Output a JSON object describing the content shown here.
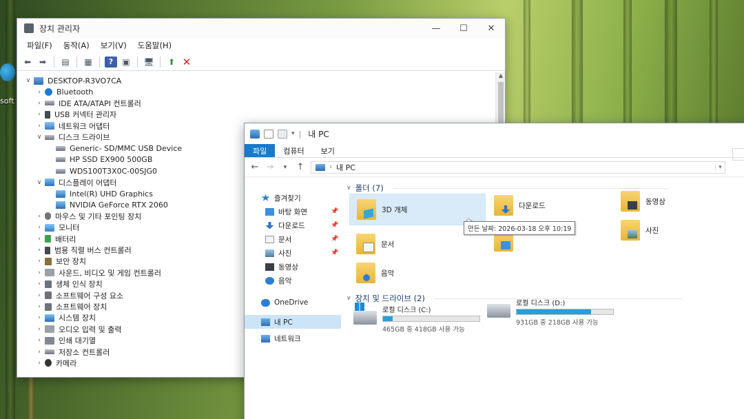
{
  "desktop": {
    "icon_label": "soft"
  },
  "device_manager": {
    "title": "장치 관리자",
    "menu": [
      "파일(F)",
      "동작(A)",
      "보기(V)",
      "도움말(H)"
    ],
    "tree": [
      {
        "label": "DESKTOP-R3VO7CA",
        "level": 0,
        "arrow": "expanded",
        "icon": "pc"
      },
      {
        "label": "Bluetooth",
        "level": 1,
        "arrow": "collapsed",
        "icon": "bt"
      },
      {
        "label": "IDE ATA/ATAPI 컨트롤러",
        "level": 1,
        "arrow": "collapsed",
        "icon": "drive"
      },
      {
        "label": "USB 커넥터 관리자",
        "level": 1,
        "arrow": "collapsed",
        "icon": "usb"
      },
      {
        "label": "네트워크 어댑터",
        "level": 1,
        "arrow": "collapsed",
        "icon": "net"
      },
      {
        "label": "디스크 드라이브",
        "level": 1,
        "arrow": "expanded",
        "icon": "drive"
      },
      {
        "label": "Generic- SD/MMC USB Device",
        "level": 2,
        "arrow": "none",
        "icon": "drive"
      },
      {
        "label": "HP SSD EX900 500GB",
        "level": 2,
        "arrow": "none",
        "icon": "drive"
      },
      {
        "label": "WDS100T3X0C-00SJG0",
        "level": 2,
        "arrow": "none",
        "icon": "drive"
      },
      {
        "label": "디스플레이 어댑터",
        "level": 1,
        "arrow": "expanded",
        "icon": "disp"
      },
      {
        "label": "Intel(R) UHD Graphics",
        "level": 2,
        "arrow": "none",
        "icon": "disp"
      },
      {
        "label": "NVIDIA GeForce RTX 2060",
        "level": 2,
        "arrow": "none",
        "icon": "disp"
      },
      {
        "label": "마우스 및 기타 포인팅 장치",
        "level": 1,
        "arrow": "collapsed",
        "icon": "mouse"
      },
      {
        "label": "모니터",
        "level": 1,
        "arrow": "collapsed",
        "icon": "mon"
      },
      {
        "label": "배터리",
        "level": 1,
        "arrow": "collapsed",
        "icon": "bat"
      },
      {
        "label": "범용 직렬 버스 컨트롤러",
        "level": 1,
        "arrow": "collapsed",
        "icon": "usb"
      },
      {
        "label": "보안 장치",
        "level": 1,
        "arrow": "collapsed",
        "icon": "sec"
      },
      {
        "label": "사운드, 비디오 및 게임 컨트롤러",
        "level": 1,
        "arrow": "collapsed",
        "icon": "snd"
      },
      {
        "label": "생체 인식 장치",
        "level": 1,
        "arrow": "collapsed",
        "icon": "gen"
      },
      {
        "label": "소프트웨어 구성 요소",
        "level": 1,
        "arrow": "collapsed",
        "icon": "gen"
      },
      {
        "label": "소프트웨어 장치",
        "level": 1,
        "arrow": "collapsed",
        "icon": "gen"
      },
      {
        "label": "시스템 장치",
        "level": 1,
        "arrow": "collapsed",
        "icon": "disp"
      },
      {
        "label": "오디오 입력 및 출력",
        "level": 1,
        "arrow": "collapsed",
        "icon": "snd"
      },
      {
        "label": "인쇄 대기열",
        "level": 1,
        "arrow": "collapsed",
        "icon": "print"
      },
      {
        "label": "저장소 컨트롤러",
        "level": 1,
        "arrow": "collapsed",
        "icon": "drive"
      },
      {
        "label": "카메라",
        "level": 1,
        "arrow": "collapsed",
        "icon": "cam"
      }
    ]
  },
  "explorer": {
    "title": "내 PC",
    "ribbon_tabs": [
      "파일",
      "컴퓨터",
      "보기"
    ],
    "address": "내 PC",
    "nav": {
      "quick_access": "즐겨찾기",
      "items": [
        {
          "label": "바탕 화면",
          "icon": "desk",
          "pinned": true
        },
        {
          "label": "다운로드",
          "icon": "down",
          "pinned": true
        },
        {
          "label": "문서",
          "icon": "doc",
          "pinned": true
        },
        {
          "label": "사진",
          "icon": "pic",
          "pinned": true
        },
        {
          "label": "동영상",
          "icon": "vid",
          "pinned": false
        },
        {
          "label": "음악",
          "icon": "music",
          "pinned": false
        }
      ],
      "onedrive": "OneDrive",
      "this_pc": "내 PC",
      "network": "네트워크"
    },
    "folders_header": "폴더 (7)",
    "folders": {
      "f3d": "3D 개체",
      "downloads": "다운로드",
      "videos": "동영상",
      "documents": "문서",
      "pictures": "사진",
      "music": "음악"
    },
    "tooltip": "만든 날짜: 2026-03-18 오후 10:19",
    "drives_header": "장치 및 드라이브 (2)",
    "drives": [
      {
        "name": "로컬 디스크 (C:)",
        "free": "465GB 중 418GB 사용 가능",
        "used_fraction": 0.1
      },
      {
        "name": "로컬 디스크 (D:)",
        "free": "931GB 중 218GB 사용 가능",
        "used_fraction": 0.77
      }
    ]
  }
}
